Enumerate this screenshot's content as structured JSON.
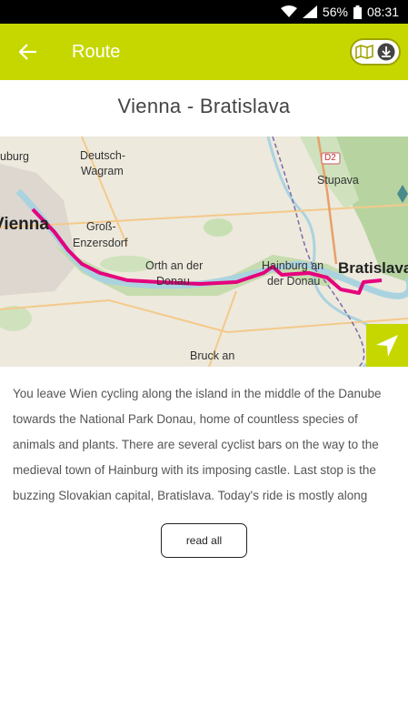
{
  "status": {
    "battery": "56%",
    "time": "08:31"
  },
  "app_bar": {
    "title": "Route"
  },
  "route": {
    "title": "Vienna - Bratislava"
  },
  "map": {
    "labels": {
      "uburg": "uburg",
      "deutsch": "Deutsch-",
      "wagram": "Wagram",
      "vienna": "Vienna",
      "gross": "Groß-",
      "enzersdorf": "Enzersdorf",
      "orth1": "Orth an der",
      "orth2": "Donau",
      "hainburg1": "Hainburg an",
      "hainburg2": "der Donau",
      "bratislava": "Bratislava",
      "stupava": "Stupava",
      "d2": "D2",
      "bruck": "Bruck an"
    }
  },
  "description": "You leave Wien cycling along the island in the middle of the Danube towards the National Park Donau, home of countless species of animals and plants. There are several cyclist bars on the way to the medieval town of Hainburg with its imposing castle. Last stop is the buzzing Slovakian capital, Bratislava. Today's ride is mostly along cycle paths and quiet roads.",
  "read_all_label": "read all",
  "colors": {
    "accent": "#c6d700",
    "route": "#e5007d",
    "water": "#aad3df"
  }
}
